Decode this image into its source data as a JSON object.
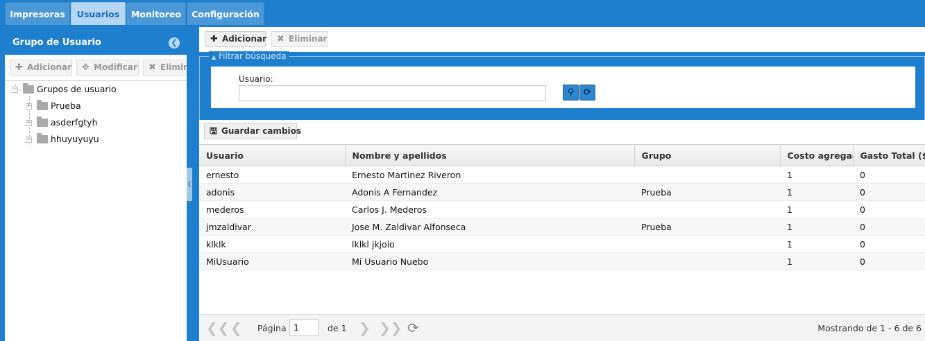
{
  "tabs": [
    "Impresoras",
    "Usuarios",
    "Monitoreo",
    "Configuración"
  ],
  "left_panel": {
    "title": "Grupo de Usuario",
    "toolbar": {
      "add": "Adicionar",
      "modify": "Modificar",
      "delete": "Eliminar"
    },
    "tree": {
      "root": "Grupos de usuario",
      "children": [
        "Prueba",
        "asderfgtyh",
        "hhuyuyuyu"
      ]
    }
  },
  "main": {
    "toolbar": {
      "add": "Adicionar",
      "delete": "Eliminar"
    },
    "filter": {
      "legend": "Filtrar búsqueda",
      "user_label": "Usuario:",
      "user_value": ""
    },
    "grid_toolbar": {
      "save": "Guardar cambios"
    },
    "columns": [
      "Usuario",
      "Nombre y apellidos",
      "Grupo",
      "Costo agregado",
      "Gasto Total ($)"
    ],
    "rows": [
      [
        "ernesto",
        "Ernesto Martinez Riveron",
        "",
        "1",
        "0"
      ],
      [
        "adonis",
        "Adonis A Fernandez",
        "Prueba",
        "1",
        "0"
      ],
      [
        "mederos",
        "Carlos J. Mederos",
        "",
        "1",
        "0"
      ],
      [
        "jmzaldivar",
        "Jose M. Zaldivar Alfonseca",
        "Prueba",
        "1",
        "0"
      ],
      [
        "klklk",
        "lklkl jkjoio",
        "",
        "1",
        "0"
      ],
      [
        "MiUsuario",
        "Mi Usuario Nuebo",
        "",
        "1",
        "0"
      ]
    ],
    "pager": {
      "page_label": "Página",
      "page_value": "1",
      "of_label": "de 1",
      "summary": "Mostrando de 1 - 6 de 6"
    }
  },
  "colors": {
    "accent": "#1d7fce",
    "active_tab": "#b5d7f2"
  }
}
